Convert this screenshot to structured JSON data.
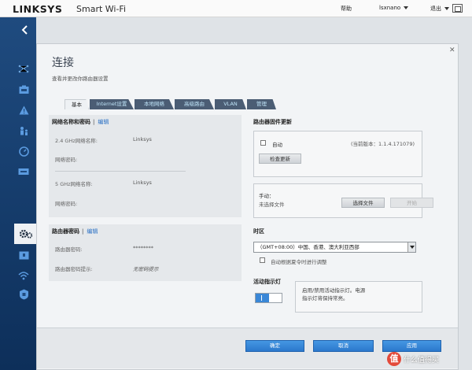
{
  "header": {
    "brand": "LINKSYS",
    "product": "Smart Wi-Fi",
    "help": "帮助",
    "user": "lsxnano",
    "logout": "退出"
  },
  "sidebar": {
    "icons": [
      "back-icon",
      "network-map-icon",
      "devices-icon",
      "alert-icon",
      "parental-controls-icon",
      "speed-test-icon",
      "external-storage-icon",
      "connectivity-icon",
      "security-icon",
      "wireless-icon",
      "router-settings-icon"
    ]
  },
  "dialog": {
    "title": "连接",
    "subtitle": "查看并更改你路由器设置",
    "tabs": [
      "基本",
      "Internet设置",
      "本地网络",
      "高级路由",
      "VLAN",
      "管理"
    ]
  },
  "network": {
    "heading": "网络名称和密码",
    "edit": "编辑",
    "ghz24_label": "2.4 GHz网络名称:",
    "ghz24_value": "Linksys",
    "pwd_label_1": "网络密码:",
    "ghz5_label": "5 GHz网络名称:",
    "ghz5_value": "Linksys",
    "pwd_label_2": "网络密码:"
  },
  "router_password": {
    "heading": "路由器密码",
    "edit": "编辑",
    "pwd_label": "路由器密码:",
    "pwd_value": "********",
    "hint_label": "路由器密码提示:",
    "hint_value": "无密码提示"
  },
  "firmware": {
    "heading": "路由器固件更新",
    "auto_label": "自动",
    "current_version": "(当前版本：1.1.4.171079)",
    "check_button": "检查更新",
    "manual_label": "手动：",
    "no_file": "未选择文件",
    "choose_file": "选择文件",
    "start": "开始"
  },
  "timezone": {
    "heading": "时区",
    "selected": "（GMT+08:00）中国、香港、澳大利亚西部",
    "dst_label": "自动根据夏令时进行调整"
  },
  "activity_light": {
    "heading": "活动指示灯",
    "description": "启用/禁用活动指示灯。电源指示灯将保持常亮。"
  },
  "footer": {
    "ok": "确定",
    "cancel": "取消",
    "apply": "应用"
  },
  "watermark": {
    "badge": "值",
    "text": "什么值得买"
  },
  "colors": {
    "sidebar": "#1f4b7f",
    "primary_button": "#2b78cc",
    "link": "#2a70c4"
  }
}
